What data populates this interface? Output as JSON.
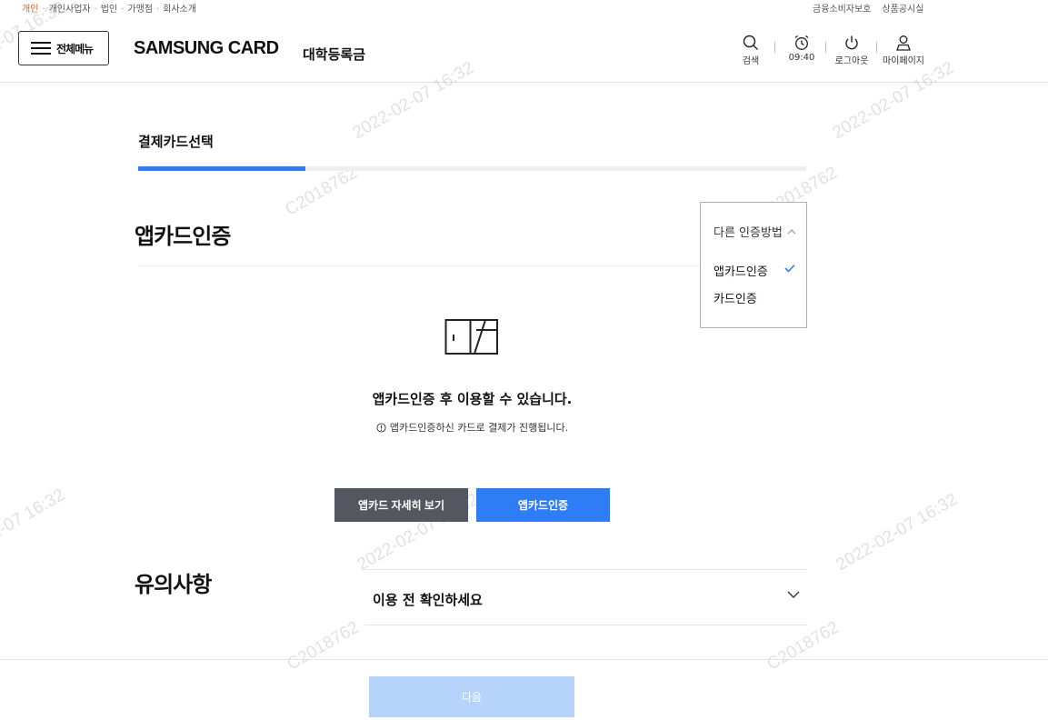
{
  "util_bar": {
    "left_links": [
      "개인",
      "개인사업자",
      "법인",
      "가맹점",
      "회사소개"
    ],
    "right_links": [
      "금융소비자보호",
      "상품공시실"
    ]
  },
  "header": {
    "menu_label": "전체메뉴",
    "logo": "SAMSUNG CARD",
    "page_name": "대학등록금",
    "tools": {
      "search": "검색",
      "time": "09:40",
      "logout": "로그아웃",
      "mypage": "마이페이지"
    }
  },
  "watermark": {
    "id": "C2018762",
    "datetime": "2022-02-07 16:32"
  },
  "step": {
    "title": "결제카드선택",
    "progress_fraction": 0.25
  },
  "auth": {
    "title": "앱카드인증",
    "method_dropdown": {
      "label": "다른 인증방법",
      "options": [
        {
          "label": "앱카드인증",
          "selected": true
        },
        {
          "label": "카드인증",
          "selected": false
        }
      ]
    },
    "message": "앱카드인증 후 이용할 수 있습니다.",
    "sub_message": "앱카드인증하신 카드로 결제가 진행됩니다.",
    "detail_button": "앱카드 자세히 보기",
    "auth_button": "앱카드인증"
  },
  "notice": {
    "title": "유의사항",
    "accordion_label": "이용 전 확인하세요"
  },
  "footer": {
    "next_button": "다음"
  },
  "colors": {
    "accent_blue": "#2e7cf6",
    "dark_button": "#54575f",
    "disabled_blue": "#b6d3fb",
    "util_active": "#e2602a"
  }
}
